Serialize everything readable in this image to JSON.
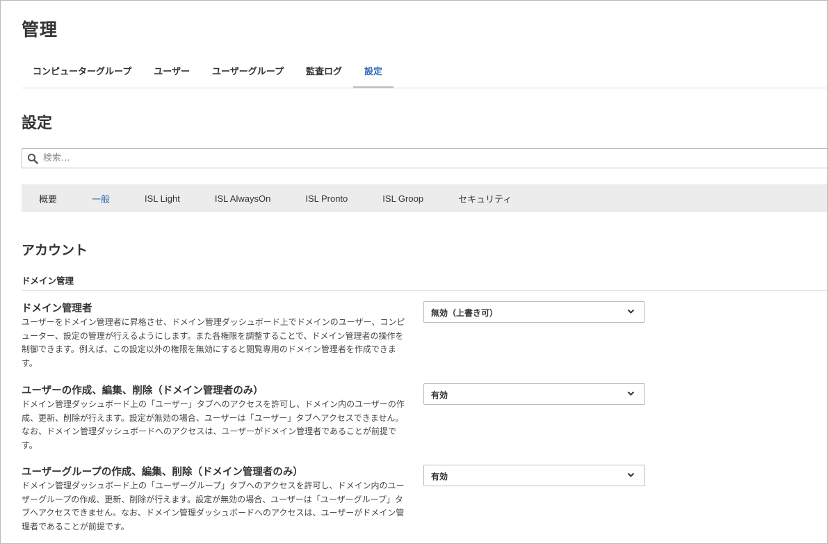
{
  "page": {
    "title": "管理"
  },
  "main_tabs": [
    {
      "label": "コンピューターグループ"
    },
    {
      "label": "ユーザー"
    },
    {
      "label": "ユーザーグループ"
    },
    {
      "label": "監査ログ"
    },
    {
      "label": "設定",
      "active": true
    }
  ],
  "settings_section": {
    "title": "設定"
  },
  "search": {
    "placeholder": "検索...",
    "icon": "search-icon"
  },
  "sub_tabs": [
    {
      "label": "概要"
    },
    {
      "label": "一般",
      "active": true
    },
    {
      "label": "ISL Light"
    },
    {
      "label": "ISL AlwaysOn"
    },
    {
      "label": "ISL Pronto"
    },
    {
      "label": "ISL Groop"
    },
    {
      "label": "セキュリティ"
    }
  ],
  "account": {
    "title": "アカウント",
    "subsection": "ドメイン管理",
    "settings": [
      {
        "title": "ドメイン管理者",
        "description": "ユーザーをドメイン管理者に昇格させ、ドメイン管理ダッシュボード上でドメインのユーザー、コンピューター、設定の管理が行えるようにします。また各権限を調整することで、ドメイン管理者の操作を制御できます。例えば、この設定以外の権限を無効にすると閲覧専用のドメイン管理者を作成できます。",
        "value": "無効（上書き可）"
      },
      {
        "title": "ユーザーの作成、編集、削除（ドメイン管理者のみ）",
        "description": "ドメイン管理ダッシュボード上の「ユーザー」タブへのアクセスを許可し、ドメイン内のユーザーの作成、更新、削除が行えます。設定が無効の場合、ユーザーは「ユーザー」タブへアクセスできません。なお、ドメイン管理ダッシュボードへのアクセスは、ユーザーがドメイン管理者であることが前提です。",
        "value": "有効"
      },
      {
        "title": "ユーザーグループの作成、編集、削除（ドメイン管理者のみ）",
        "description": "ドメイン管理ダッシュボード上の「ユーザーグループ」タブへのアクセスを許可し、ドメイン内のユーザーグループの作成、更新、削除が行えます。設定が無効の場合、ユーザーは「ユーザーグループ」タブへアクセスできません。なお、ドメイン管理ダッシュボードへのアクセスは、ユーザーがドメイン管理者であることが前提です。",
        "value": "有効"
      }
    ]
  },
  "colors": {
    "accent": "#2a6ab5",
    "subtab_background": "#ececec",
    "border": "#bdbdbd"
  }
}
